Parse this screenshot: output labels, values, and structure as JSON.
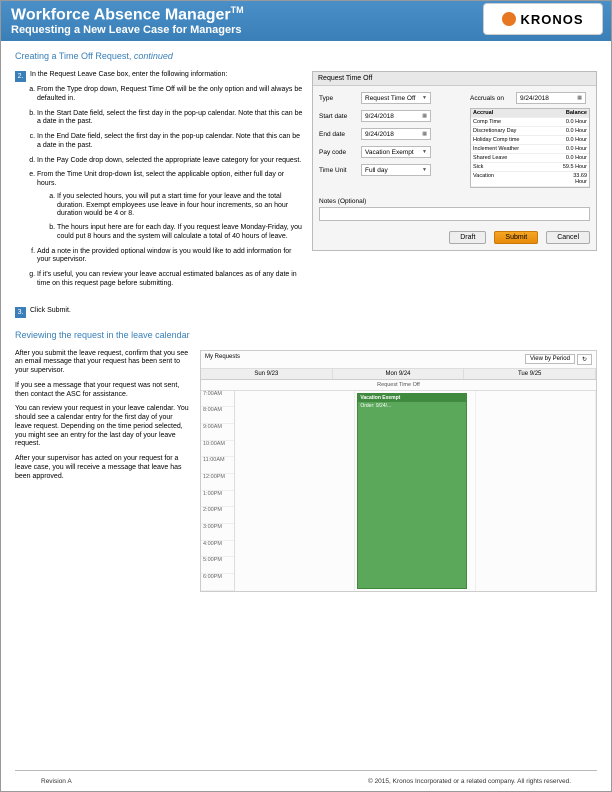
{
  "header": {
    "title": "Workforce Absence Manager",
    "tm": "TM",
    "subtitle": "Requesting a New Leave Case for Managers",
    "logo_text": "KRONOS"
  },
  "section1": {
    "title_a": "Creating a Time Off Request, ",
    "title_b": "continued",
    "step2_num": "2.",
    "step2_intro": "In the Request Leave Case box, enter the following information:",
    "items": {
      "a": "From the Type drop down, Request Time Off will be the only option and will always be defaulted in.",
      "b": "In the Start Date field, select the first day in the pop-up calendar. Note that this can be a date in the past.",
      "c": "In the End Date field, select the first day in the pop-up calendar. Note that this can be a date in the past.",
      "d": "In the Pay Code drop down, selected the appropriate leave category for your request.",
      "e": "From the Time Unit drop-down list, select the applicable option, either full day or hours.",
      "e_a": "If you selected hours, you will put a start time for your leave and the total duration. Exempt employees use leave in four hour increments, so an hour duration would be 4 or 8.",
      "e_b": "The hours input here are for each day. If you request leave Monday-Friday, you could put 8 hours and the system will calculate a total of 40 hours of leave.",
      "f": "Add a note in the provided optional window is you would like to add information for your supervisor.",
      "g": "If it's useful, you can review your leave accrual estimated balances as of any date in time on this request page before submitting."
    },
    "step3_num": "3.",
    "step3": "Click Submit."
  },
  "dialog": {
    "title": "Request Time Off",
    "labels": {
      "type": "Type",
      "start": "Start date",
      "end": "End date",
      "pay": "Pay code",
      "unit": "Time Unit",
      "accruals_on": "Accruals on",
      "accrual": "Accrual",
      "balance": "Balance",
      "notes": "Notes (Optional)"
    },
    "values": {
      "type": "Request Time Off",
      "start": "9/24/2018",
      "end": "9/24/2018",
      "pay": "Vacation Exempt",
      "unit": "Full day",
      "accruals_on": "9/24/2018"
    },
    "accruals": [
      {
        "name": "Comp Time",
        "bal": "0.0 Hour"
      },
      {
        "name": "Discretionary Day",
        "bal": "0.0 Hour"
      },
      {
        "name": "Holiday Comp time",
        "bal": "0.0 Hour"
      },
      {
        "name": "Inclement Weather",
        "bal": "0.0 Hour"
      },
      {
        "name": "Shared Leave",
        "bal": "0.0 Hour"
      },
      {
        "name": "Sick",
        "bal": "59.5 Hour"
      },
      {
        "name": "Vacation",
        "bal": "33.69 Hour"
      }
    ],
    "buttons": {
      "draft": "Draft",
      "submit": "Submit",
      "cancel": "Cancel"
    }
  },
  "review": {
    "title": "Reviewing the request in the leave calendar",
    "p1": "After you submit the leave request, confirm that you see an email message that your request has been sent to your supervisor.",
    "p2": "If you see a message that your request was not sent, then contact the ASC for assistance.",
    "p3": "You can review your request in your leave calendar. You should see a calendar entry for the first day of your leave request. Depending on the time period selected, you might see an entry for the last day of your leave request.",
    "p4": "After your supervisor has acted on your request for a leave case, you will receive a message that leave has been approved."
  },
  "calendar": {
    "toolbar_title": "My Requests",
    "filter_label": "View by Period",
    "day_headers": [
      "Sun 9/23",
      "Mon 9/24",
      "Tue 9/25"
    ],
    "sub_label": "Request Time Off",
    "times": [
      "7:00AM",
      "8:00AM",
      "9:00AM",
      "10:00AM",
      "11:00AM",
      "12:00PM",
      "1:00PM",
      "2:00PM",
      "3:00PM",
      "4:00PM",
      "5:00PM",
      "6:00PM"
    ],
    "event_title": "Vacation Exempt",
    "event_sub": "Order: 9/24/..."
  },
  "footer": {
    "rev": "Revision A",
    "copyright": "© 2015, Kronos Incorporated or a related company. All rights reserved."
  }
}
